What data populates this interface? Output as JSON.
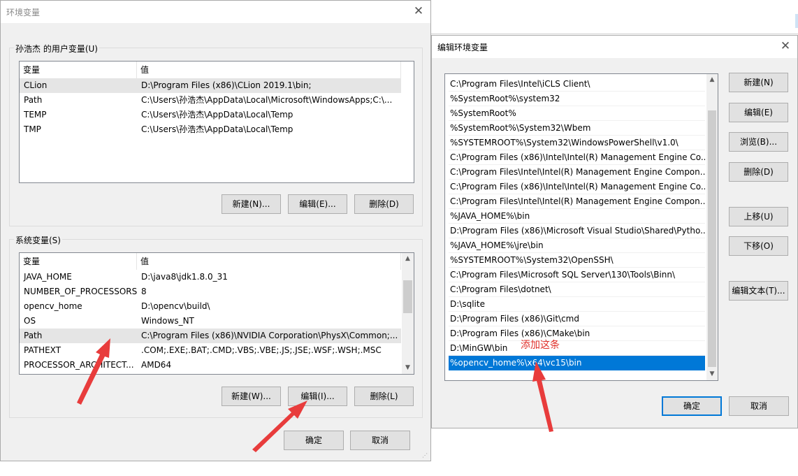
{
  "env_dialog": {
    "title": "环境变量",
    "user_group_label": "孙浩杰 的用户变量(U)",
    "sys_group_label": "系统变量(S)",
    "headers": [
      "变量",
      "值"
    ],
    "user_rows": [
      {
        "name": "CLion",
        "value": "D:\\Program Files (x86)\\CLion 2019.1\\bin;"
      },
      {
        "name": "Path",
        "value": "C:\\Users\\孙浩杰\\AppData\\Local\\Microsoft\\WindowsApps;C:\\..."
      },
      {
        "name": "TEMP",
        "value": "C:\\Users\\孙浩杰\\AppData\\Local\\Temp"
      },
      {
        "name": "TMP",
        "value": "C:\\Users\\孙浩杰\\AppData\\Local\\Temp"
      }
    ],
    "system_rows": [
      {
        "name": "JAVA_HOME",
        "value": "D:\\java8\\jdk1.8.0_31"
      },
      {
        "name": "NUMBER_OF_PROCESSORS",
        "value": "8"
      },
      {
        "name": "opencv_home",
        "value": "D:\\opencv\\build\\"
      },
      {
        "name": "OS",
        "value": "Windows_NT"
      },
      {
        "name": "Path",
        "value": "C:\\Program Files (x86)\\NVIDIA Corporation\\PhysX\\Common;..."
      },
      {
        "name": "PATHEXT",
        "value": ".COM;.EXE;.BAT;.CMD;.VBS;.VBE;.JS;.JSE;.WSF;.WSH;.MSC"
      },
      {
        "name": "PROCESSOR_ARCHITECT...",
        "value": "AMD64"
      }
    ],
    "user_buttons": {
      "new": "新建(N)...",
      "edit": "编辑(E)...",
      "delete": "删除(D)"
    },
    "sys_buttons": {
      "new": "新建(W)...",
      "edit": "编辑(I)...",
      "delete": "删除(L)"
    },
    "ok": "确定",
    "cancel": "取消"
  },
  "edit_dialog": {
    "title": "编辑环境变量",
    "items": [
      "C:\\Program Files\\Intel\\iCLS Client\\",
      "%SystemRoot%\\system32",
      "%SystemRoot%",
      "%SystemRoot%\\System32\\Wbem",
      "%SYSTEMROOT%\\System32\\WindowsPowerShell\\v1.0\\",
      "C:\\Program Files (x86)\\Intel\\Intel(R) Management Engine Co...",
      "C:\\Program Files\\Intel\\Intel(R) Management Engine Compon...",
      "C:\\Program Files (x86)\\Intel\\Intel(R) Management Engine Co...",
      "C:\\Program Files\\Intel\\Intel(R) Management Engine Compon...",
      "%JAVA_HOME%\\bin",
      "D:\\Program Files (x86)\\Microsoft Visual Studio\\Shared\\Pytho...",
      "%JAVA_HOME%\\jre\\bin",
      "%SYSTEMROOT%\\System32\\OpenSSH\\",
      "C:\\Program Files\\Microsoft SQL Server\\130\\Tools\\Binn\\",
      "C:\\Program Files\\dotnet\\",
      "D:\\sqlite",
      "D:\\Program Files (x86)\\Git\\cmd",
      "D:\\Program Files (x86)\\CMake\\bin",
      "D:\\MinGW\\bin",
      "%opencv_home%\\x64\\vc15\\bin"
    ],
    "selected_index": 19,
    "buttons": {
      "new": "新建(N)",
      "edit": "编辑(E)",
      "browse": "浏览(B)...",
      "delete": "删除(D)",
      "up": "上移(U)",
      "down": "下移(O)",
      "edit_text": "编辑文本(T)..."
    },
    "ok": "确定",
    "cancel": "取消"
  },
  "annotation": "添加这条",
  "colors": {
    "selection": "#0078d7",
    "annotation": "#e0302a",
    "dialog_bg": "#f0f0f0"
  }
}
